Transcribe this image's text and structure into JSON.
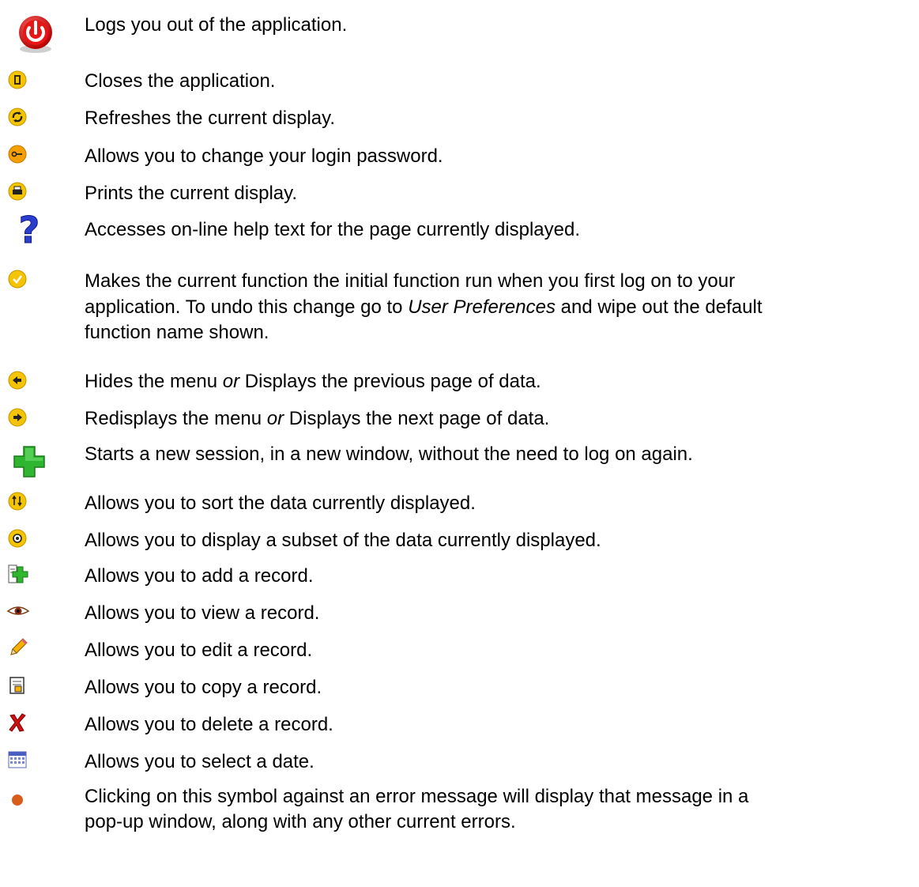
{
  "items": [
    {
      "icon": "power-icon",
      "text": "Logs you out of the application."
    },
    {
      "icon": "exit-door-icon",
      "text": "Closes the application."
    },
    {
      "icon": "refresh-icon",
      "text": "Refreshes the current display."
    },
    {
      "icon": "key-icon",
      "text": "Allows you to change your login password."
    },
    {
      "icon": "printer-icon",
      "text": "Prints the current display."
    },
    {
      "icon": "help-question-icon",
      "text": "Accesses on-line help text for the page currently displayed."
    },
    {
      "icon": "checkmark-icon",
      "line1": "Makes the current function the initial function run when you first log on to your",
      "line2_pre": "application. To undo this change go to ",
      "line2_em": "User Preferences",
      "line2_post": " and wipe out the default",
      "line3": "function name shown."
    },
    {
      "icon": "arrow-left-icon",
      "pre": "Hides the menu ",
      "em": "or",
      "post": " Displays the previous page of data."
    },
    {
      "icon": "arrow-right-icon",
      "pre": "Redisplays the menu ",
      "em": "or",
      "post": " Displays the next page of data."
    },
    {
      "icon": "new-session-plus-icon",
      "text": "Starts a new session, in a new window, without the need to log on again."
    },
    {
      "icon": "sort-icon",
      "text": "Allows you to sort the data currently displayed."
    },
    {
      "icon": "filter-icon",
      "text": "Allows you to display a subset of the data currently displayed."
    },
    {
      "icon": "add-record-icon",
      "text": "Allows you to add a record."
    },
    {
      "icon": "view-eye-icon",
      "text": "Allows you to view a record."
    },
    {
      "icon": "edit-pencil-icon",
      "text": "Allows you to edit a record."
    },
    {
      "icon": "copy-record-icon",
      "text": "Allows you to copy a record."
    },
    {
      "icon": "delete-x-icon",
      "text": "Allows you to delete a record."
    },
    {
      "icon": "calendar-icon",
      "text": "Allows you to select a date."
    },
    {
      "icon": "error-dot-icon",
      "line1": "Clicking on this symbol against an error message will display that message in a",
      "line2": "pop-up window, along with any other current errors."
    }
  ]
}
